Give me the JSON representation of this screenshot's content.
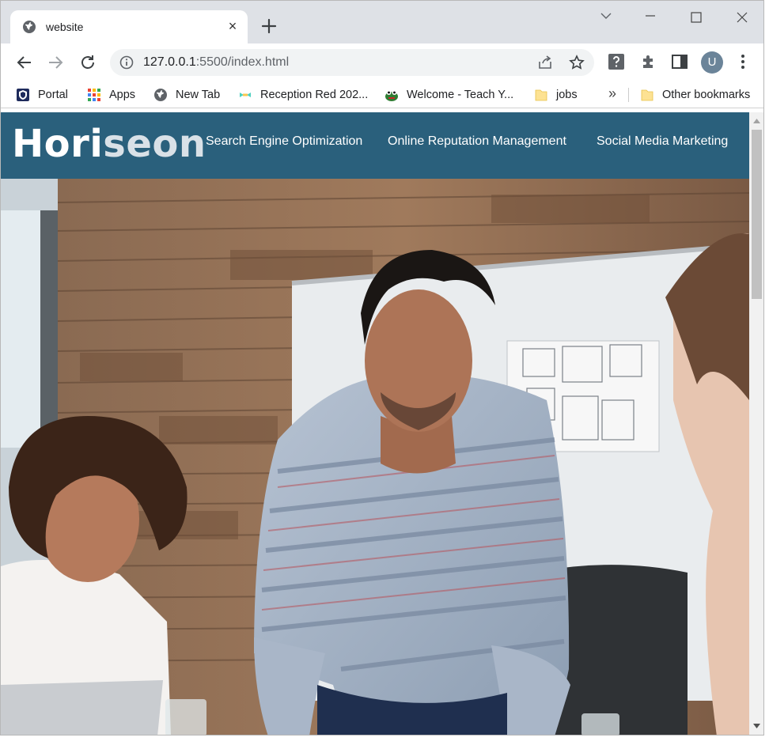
{
  "browser": {
    "tab": {
      "title": "website",
      "close_glyph": "×"
    },
    "url": {
      "host": "127.0.0.1",
      "rest": ":5500/index.html"
    },
    "profile_initial": "U"
  },
  "bookmarks": [
    {
      "label": "Portal",
      "icon": "portal-shield-icon"
    },
    {
      "label": "Apps",
      "icon": "apps-grid-icon"
    },
    {
      "label": "New Tab",
      "icon": "globe-icon"
    },
    {
      "label": "Reception Red 202...",
      "icon": "reception-icon"
    },
    {
      "label": "Welcome - Teach Y...",
      "icon": "frog-icon"
    },
    {
      "label": "jobs",
      "icon": "folder-icon"
    }
  ],
  "bookmarks_overflow": "»",
  "other_bookmarks": "Other bookmarks",
  "site": {
    "logo_main": "Hori",
    "logo_accent": "seon",
    "nav": [
      "Search Engine Optimization",
      "Online Reputation Management",
      "Social Media Marketing"
    ],
    "header_color": "#2a607c"
  },
  "hero": {
    "description": "Photo of a team meeting around a table in front of a wood-paneled wall and whiteboard"
  }
}
